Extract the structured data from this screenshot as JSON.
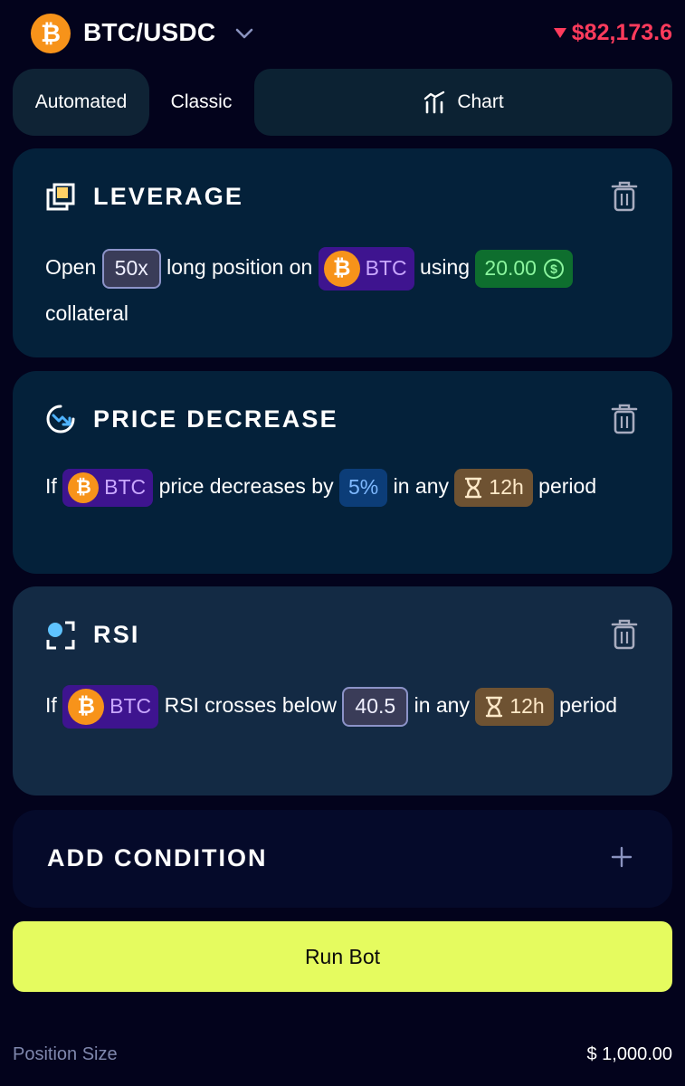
{
  "header": {
    "pair": "BTC/USDC",
    "pair_icon": "bitcoin-icon",
    "price": "$82,173.6",
    "price_direction": "down",
    "price_color": "#ff3b5c"
  },
  "tabs": {
    "automated": "Automated",
    "classic": "Classic",
    "chart": "Chart"
  },
  "cards": {
    "leverage": {
      "title": "LEVERAGE",
      "open": "Open",
      "leverage_value": "50x",
      "long_position_on": "long position on",
      "coin": "BTC",
      "using": "using",
      "collateral_value": "20.00",
      "collateral": "collateral"
    },
    "price_decrease": {
      "title": "PRICE DECREASE",
      "if": "If",
      "coin": "BTC",
      "price_decreases_by": "price decreases by",
      "percent": "5%",
      "in_any": "in any",
      "period_value": "12h",
      "period": "period"
    },
    "rsi": {
      "title": "RSI",
      "if": "If",
      "coin": "BTC",
      "rsi_crosses_below": "RSI crosses below",
      "threshold": "40.5",
      "in_any": "in any",
      "period_value": "12h",
      "period": "period"
    }
  },
  "add_condition": {
    "label": "ADD CONDITION"
  },
  "run_button": "Run Bot",
  "position_size": {
    "label": "Position Size",
    "value": "$ 1,000.00"
  },
  "colors": {
    "background": "#03031c",
    "accent_button": "#e5fb5f",
    "btc": "#f7931a",
    "price_down": "#ff3b5c"
  }
}
